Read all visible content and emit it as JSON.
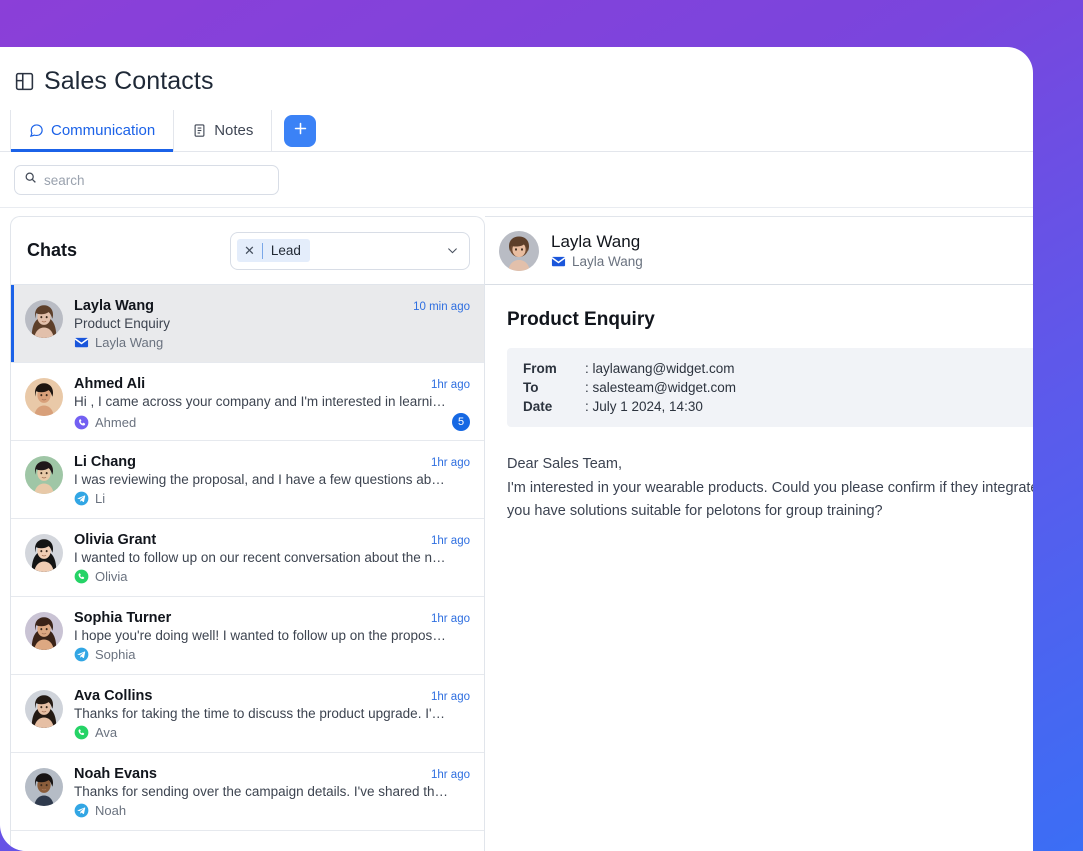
{
  "header": {
    "title": "Sales Contacts",
    "layout_icon": "layout-panel-icon",
    "tabs": [
      {
        "label": "Communication",
        "icon": "chat-bubble-icon",
        "active": true
      },
      {
        "label": "Notes",
        "icon": "note-icon",
        "active": false
      }
    ],
    "add_button": {
      "icon": "plus-icon",
      "label": "+"
    }
  },
  "search": {
    "placeholder": "search",
    "value": "",
    "icon": "search-icon"
  },
  "chats_panel": {
    "title": "Chats",
    "filter": {
      "chip_label": "Lead",
      "clear_icon": "close-icon",
      "caret_icon": "chevron-down-icon"
    },
    "items": [
      {
        "name": "Layla Wang",
        "preview": "Product Enquiry",
        "time": "10 min ago",
        "channel": "email",
        "handle": "Layla Wang",
        "unread": "",
        "selected": true
      },
      {
        "name": "Ahmed Ali",
        "preview": "Hi , I came across your company and I'm interested in learning m...",
        "time": "1hr ago",
        "channel": "viber",
        "handle": "Ahmed",
        "unread": "5",
        "selected": false
      },
      {
        "name": "Li Chang",
        "preview": "I was reviewing the proposal, and I have a few questions about t...",
        "time": "1hr ago",
        "channel": "telegram",
        "handle": "Li",
        "unread": "",
        "selected": false
      },
      {
        "name": "Olivia Grant",
        "preview": "I wanted to follow up on our recent conversation about the new...",
        "time": "1hr ago",
        "channel": "whatsapp",
        "handle": "Olivia",
        "unread": "",
        "selected": false
      },
      {
        "name": "Sophia Turner",
        "preview": "I hope you're doing well! I wanted to follow up on the proposal w...",
        "time": "1hr ago",
        "channel": "telegram",
        "handle": "Sophia",
        "unread": "",
        "selected": false
      },
      {
        "name": "Ava Collins",
        "preview": "Thanks for taking the time to discuss the product upgrade. I've h...",
        "time": "1hr ago",
        "channel": "whatsapp",
        "handle": "Ava",
        "unread": "",
        "selected": false
      },
      {
        "name": "Noah Evans",
        "preview": "Thanks for sending over the campaign details. I've shared the pr...",
        "time": "1hr ago",
        "channel": "telegram",
        "handle": "Noah",
        "unread": "",
        "selected": false
      }
    ]
  },
  "detail": {
    "contact_name": "Layla Wang",
    "channel": "email",
    "channel_handle": "Layla Wang",
    "subject": "Product Enquiry",
    "meta": [
      {
        "key": "From",
        "value": ": laylawang@widget.com"
      },
      {
        "key": "To",
        "value": ": salesteam@widget.com"
      },
      {
        "key": "Date",
        "value": ": July 1 2024, 14:30"
      }
    ],
    "message": "Dear Sales Team,\nI'm interested in your wearable products. Could you please confirm if they integrate with OSMAnd? Additionally, do you have solutions suitable for pelotons for group training?"
  },
  "colors": {
    "accent_blue": "#1b62e8",
    "add_button": "#3b82f6",
    "gradient_start": "#8b3fd8",
    "gradient_end": "#3b6ef5",
    "selected_row": "#e9eaec",
    "meta_box": "#f1f3f7"
  }
}
